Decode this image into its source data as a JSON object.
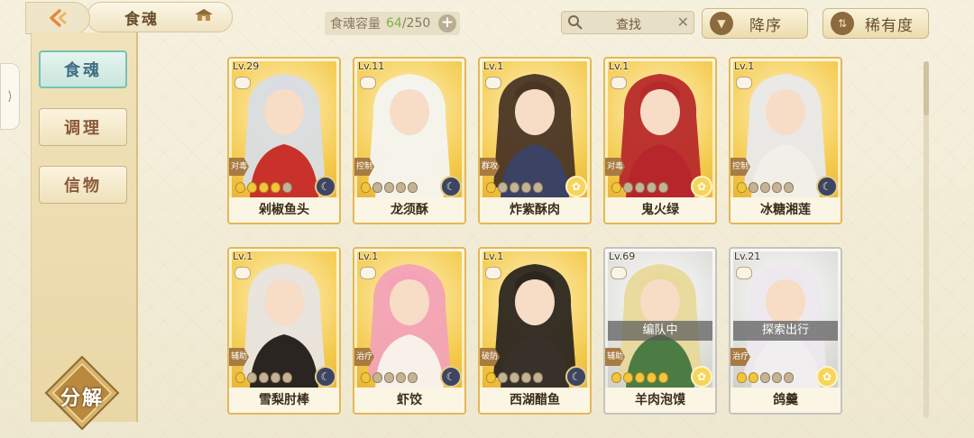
{
  "header": {
    "title": "食魂",
    "capacity_label": "食魂容量",
    "capacity_current": "64",
    "capacity_max": "/250",
    "plus_label": "+",
    "search_label": "查找",
    "clear_label": "✕",
    "sort_order_label": "降序",
    "sort_by_label": "稀有度"
  },
  "sidebar": {
    "items": [
      {
        "label": "食魂"
      },
      {
        "label": "调理"
      },
      {
        "label": "信物"
      }
    ],
    "decompose_label": "分解",
    "handle_label": "⟩"
  },
  "colors": {
    "gold_frame": "#e5b757",
    "silver_frame": "#c4c3c0",
    "accent_teal": "#79c0b6"
  },
  "cards": [
    {
      "level": "Lv.29",
      "role": "对毒",
      "name": "剁椒鱼头",
      "stars": 4,
      "element": "moon-icon",
      "frame": "gold",
      "hair": "#d9dde3",
      "outfit": "#c8322b"
    },
    {
      "level": "Lv.11",
      "role": "控制",
      "name": "龙须酥",
      "stars": 1,
      "element": "moon-icon",
      "frame": "gold",
      "hair": "#f4f4f0",
      "outfit": "#f5f3ea"
    },
    {
      "level": "Lv.1",
      "role": "群攻",
      "name": "炸紫酥肉",
      "stars": 1,
      "element": "sun-icon",
      "frame": "gold",
      "hair": "#4a3524",
      "outfit": "#3b4263"
    },
    {
      "level": "Lv.1",
      "role": "对毒",
      "name": "鬼火绿",
      "stars": 1,
      "element": "sun-icon",
      "frame": "gold",
      "hair": "#b82a2a",
      "outfit": "#b7262b"
    },
    {
      "level": "Lv.1",
      "role": "控制",
      "name": "冰糖湘莲",
      "stars": 1,
      "element": "moon-icon",
      "frame": "gold",
      "hair": "#e9e9ea",
      "outfit": "#f1efe8"
    },
    {
      "level": "Lv.1",
      "role": "辅助",
      "name": "雪梨肘棒",
      "stars": 1,
      "element": "moon-icon",
      "frame": "gold",
      "hair": "#e8e4e0",
      "outfit": "#2a2521"
    },
    {
      "level": "Lv.1",
      "role": "治疗",
      "name": "虾饺",
      "stars": 1,
      "element": "moon-icon",
      "frame": "gold",
      "hair": "#f3a2b7",
      "outfit": "#f7f1ea"
    },
    {
      "level": "Lv.1",
      "role": "破防",
      "name": "西湖醋鱼",
      "stars": 1,
      "element": "moon-icon",
      "frame": "gold",
      "hair": "#2b2620",
      "outfit": "#3a302a"
    },
    {
      "level": "Lv.69",
      "role": "辅助",
      "name": "羊肉泡馍",
      "stars": 5,
      "element": "sun-icon",
      "frame": "silver",
      "status": "编队中",
      "hair": "#e8d89a",
      "outfit": "#4d7b44"
    },
    {
      "level": "Lv.21",
      "role": "治疗",
      "name": "鸽羹",
      "stars": 2,
      "element": "sun-icon",
      "frame": "silver",
      "status": "探索出行",
      "hair": "#ece8ee",
      "outfit": "#f1eef0"
    }
  ]
}
